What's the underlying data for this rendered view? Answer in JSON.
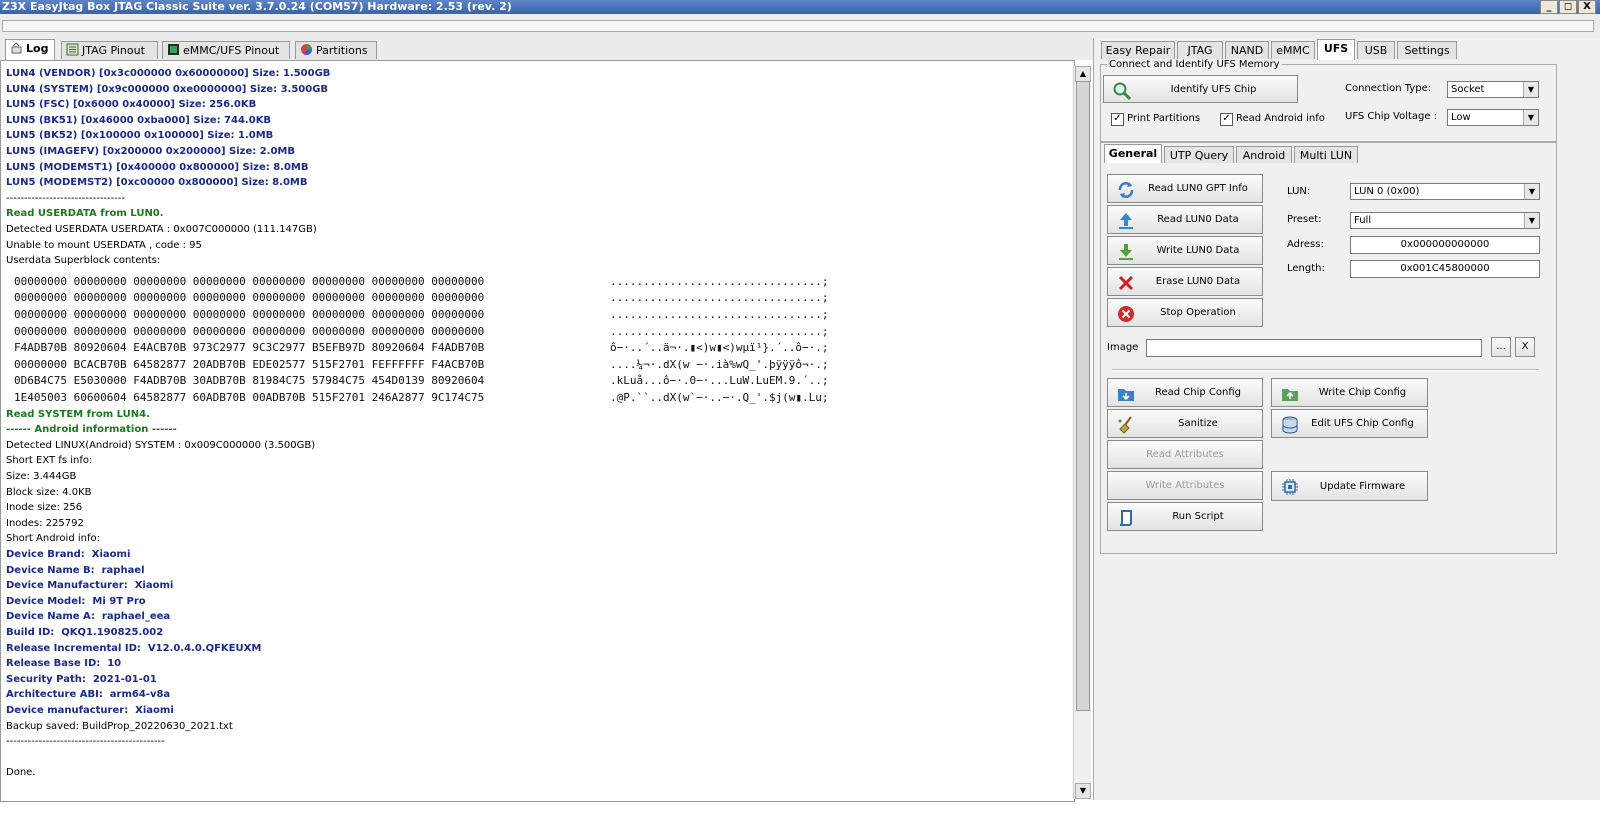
{
  "window": {
    "title": "Z3X EasyJtag Box JTAG Classic Suite ver. 3.7.0.24 (COM57) Hardware: 2.53 (rev. 2)",
    "controls": [
      "_",
      "◻",
      "X"
    ]
  },
  "progress": {
    "value": 0
  },
  "left_tabs": [
    {
      "label": "Log",
      "icon": "log-icon",
      "active": true
    },
    {
      "label": "JTAG Pinout",
      "icon": "jtag-pinout-icon",
      "active": false
    },
    {
      "label": "eMMC/UFS Pinout",
      "icon": "chip-pinout-icon",
      "active": false
    },
    {
      "label": "Partitions",
      "icon": "pie-chart-icon",
      "active": false
    }
  ],
  "log": {
    "lines_top": [
      {
        "text": "LUN4 (VENDOR) [0x3c000000 0x60000000] Size: 1.500GB",
        "style": "blue"
      },
      {
        "text": "LUN4 (SYSTEM) [0x9c000000 0xe0000000] Size: 3.500GB",
        "style": "blue"
      },
      {
        "text": "LUN5 (FSC) [0x6000 0x40000] Size: 256.0KB",
        "style": "blue"
      },
      {
        "text": "LUN5 (BK51) [0x46000 0xba000] Size: 744.0KB",
        "style": "blue"
      },
      {
        "text": "LUN5 (BK52) [0x100000 0x100000] Size: 1.0MB",
        "style": "blue"
      },
      {
        "text": "LUN5 (IMAGEFV) [0x200000 0x200000] Size: 2.0MB",
        "style": "blue"
      },
      {
        "text": "LUN5 (MODEMST1) [0x400000 0x800000] Size: 8.0MB",
        "style": "blue"
      },
      {
        "text": "LUN5 (MODEMST2) [0xc00000 0x800000] Size: 8.0MB",
        "style": "blue"
      },
      {
        "text": "---------------------------------",
        "style": "black"
      },
      {
        "text": "Read USERDATA from LUN0.",
        "style": "green"
      },
      {
        "text": "Detected USERDATA USERDATA : 0x007C000000 (111.147GB)",
        "style": "black"
      },
      {
        "text": "Unable to mount USERDATA , code : 95",
        "style": "black"
      },
      {
        "text": "Userdata Superblock contents:",
        "style": "black"
      }
    ],
    "hex_rows": [
      "00000000 00000000 00000000 00000000 00000000 00000000 00000000 00000000",
      "00000000 00000000 00000000 00000000 00000000 00000000 00000000 00000000",
      "00000000 00000000 00000000 00000000 00000000 00000000 00000000 00000000",
      "00000000 00000000 00000000 00000000 00000000 00000000 00000000 00000000",
      "F4ADB70B 80920604 E4ACB70B 973C2977 9C3C2977 B5EFB97D 80920604 F4ADB70B",
      "00000000 BCACB70B 64582877 20ADB70B EDE02577 515F2701 FEFFFFFF F4ACB70B",
      "0D6B4C75 E5030000 F4ADB70B 30ADB70B 81984C75 57984C75 454D0139 80920604",
      "1E405003 60600604 64582877 60ADB70B 00ADB70B 515F2701 246A2877 9C174C75"
    ],
    "ascii_rows": [
      "................................;",
      "................................;",
      "................................;",
      "................................;",
      "ô−·..´..ä¬·.▮<)w▮<)wµï¹}.´..ô−·.;",
      "....¼¬·.dX(w −·.ià%wQ_'.þÿÿÿô¬·.;",
      ".kLuå...ô−·.0−·...LuW.LuEM.9.´..;",
      ".@P.``..dX(w`−·..−·.Q_'.$j(w▮.Lu;"
    ],
    "lines_bottom": [
      {
        "text": "Read SYSTEM from LUN4.",
        "style": "green"
      },
      {
        "text": "------ Android information ------",
        "style": "green"
      },
      {
        "text": "Detected LINUX(Android) SYSTEM : 0x009C000000 (3.500GB)",
        "style": "black"
      },
      {
        "text": "Short EXT fs info:",
        "style": "black"
      },
      {
        "text": "Size: 3.444GB",
        "style": "black"
      },
      {
        "text": "Block size: 4.0KB",
        "style": "black"
      },
      {
        "text": "Inode size: 256",
        "style": "black"
      },
      {
        "text": "Inodes: 225792",
        "style": "black"
      },
      {
        "text": "Short Android info:",
        "style": "black"
      },
      {
        "text": "Device Brand:  Xiaomi",
        "style": "blue"
      },
      {
        "text": "Device Name B:  raphael",
        "style": "blue"
      },
      {
        "text": "Device Manufacturer:  Xiaomi",
        "style": "blue"
      },
      {
        "text": "Device Model:  Mi 9T Pro",
        "style": "blue"
      },
      {
        "text": "Device Name A:  raphael_eea",
        "style": "blue"
      },
      {
        "text": "Build ID:  QKQ1.190825.002",
        "style": "blue"
      },
      {
        "text": "Release Incremental ID:  V12.0.4.0.QFKEUXM",
        "style": "blue"
      },
      {
        "text": "Release Base ID:  10",
        "style": "blue"
      },
      {
        "text": "Security Path:  2021-01-01",
        "style": "blue"
      },
      {
        "text": "Architecture ABI:  arm64-v8a",
        "style": "blue"
      },
      {
        "text": "Device manufacturer:  Xiaomi",
        "style": "blue"
      },
      {
        "text": "Backup saved: BuildProp_20220630_2021.txt",
        "style": "black"
      },
      {
        "text": "--------------------------------------------",
        "style": "black"
      },
      {
        "text": "",
        "style": "black"
      },
      {
        "text": "Done.",
        "style": "black"
      }
    ]
  },
  "right_tabs": [
    {
      "label": "Easy Repair",
      "active": false
    },
    {
      "label": "JTAG",
      "active": false
    },
    {
      "label": "NAND",
      "active": false
    },
    {
      "label": "eMMC",
      "active": false
    },
    {
      "label": "UFS",
      "active": true
    },
    {
      "label": "USB",
      "active": false
    },
    {
      "label": "Settings",
      "active": false
    }
  ],
  "connect_group": {
    "legend": "Connect and Identify UFS Memory",
    "identify_button": "Identify UFS Chip",
    "print_partitions": {
      "label": "Print Partitions",
      "checked": true
    },
    "read_android_info": {
      "label": "Read Android info",
      "checked": true
    },
    "connection_type_label": "Connection Type:",
    "connection_type_value": "Socket",
    "voltage_label": "UFS Chip Voltage :",
    "voltage_value": "Low"
  },
  "inner_tabs": [
    {
      "label": "General",
      "active": true
    },
    {
      "label": "UTP Query",
      "active": false
    },
    {
      "label": "Android",
      "active": false
    },
    {
      "label": "Multi LUN",
      "active": false
    }
  ],
  "general": {
    "buttons": [
      {
        "label": "Read LUN0 GPT Info",
        "icon": "refresh-icon",
        "disabled": false
      },
      {
        "label": "Read LUN0 Data",
        "icon": "upload-icon",
        "disabled": false
      },
      {
        "label": "Write LUN0 Data",
        "icon": "download-icon",
        "disabled": false
      },
      {
        "label": "Erase LUN0 Data",
        "icon": "erase-icon",
        "disabled": false
      },
      {
        "label": "Stop Operation",
        "icon": "stop-icon",
        "disabled": false
      }
    ],
    "lun_label": "LUN:",
    "lun_value": "LUN 0 (0x00)",
    "preset_label": "Preset:",
    "preset_value": "Full",
    "address_label": "Adress:",
    "address_value": "0x000000000000",
    "length_label": "Length:",
    "length_value": "0x001C45800000",
    "image_label": "Image",
    "image_value": "",
    "browse_label": "...",
    "clear_label": "X",
    "left_buttons": [
      {
        "label": "Read Chip Config",
        "icon": "read-config-icon",
        "disabled": false
      },
      {
        "label": "Sanitize",
        "icon": "broom-icon",
        "disabled": false
      },
      {
        "label": "Read Attributes",
        "icon": "",
        "disabled": true
      },
      {
        "label": "Write Attributes",
        "icon": "",
        "disabled": true
      },
      {
        "label": "Run Script",
        "icon": "script-icon",
        "disabled": false
      }
    ],
    "right_buttons": [
      {
        "label": "Write Chip Config",
        "icon": "write-config-icon"
      },
      {
        "label": "Edit UFS Chip Config",
        "icon": "database-icon"
      },
      {
        "label": "Update Firmware",
        "icon": "chip-icon"
      }
    ]
  }
}
